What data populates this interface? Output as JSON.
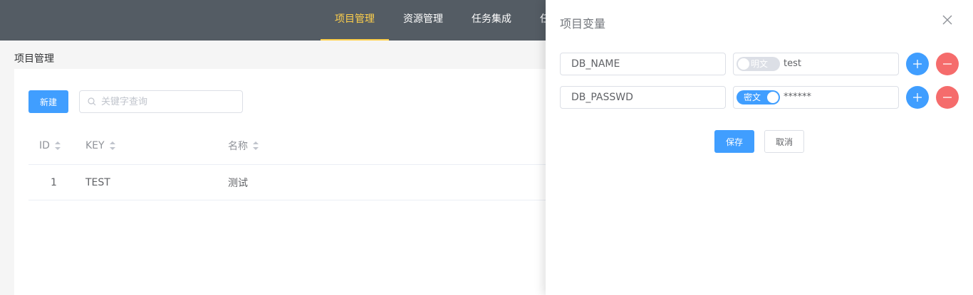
{
  "nav": {
    "items": [
      {
        "label": "项目管理",
        "active": true
      },
      {
        "label": "资源管理",
        "active": false
      },
      {
        "label": "任务集成",
        "active": false
      },
      {
        "label": "任",
        "active": false
      }
    ]
  },
  "page": {
    "breadcrumb": "项目管理",
    "new_button": "新建",
    "search_placeholder": "关键字查询",
    "table": {
      "columns": [
        "ID",
        "KEY",
        "名称"
      ],
      "rows": [
        {
          "id": "1",
          "key": "TEST",
          "name": "测试"
        }
      ]
    }
  },
  "drawer": {
    "title": "项目变量",
    "variables": [
      {
        "key": "DB_NAME",
        "toggle_label": "明文",
        "secret": false,
        "value": "test"
      },
      {
        "key": "DB_PASSWD",
        "toggle_label": "密文",
        "secret": true,
        "value": "******"
      }
    ],
    "save_label": "保存",
    "cancel_label": "取消"
  },
  "colors": {
    "nav_bg": "#545c64",
    "nav_active": "#ffd04b",
    "primary": "#409eff",
    "danger": "#f56c6c"
  }
}
